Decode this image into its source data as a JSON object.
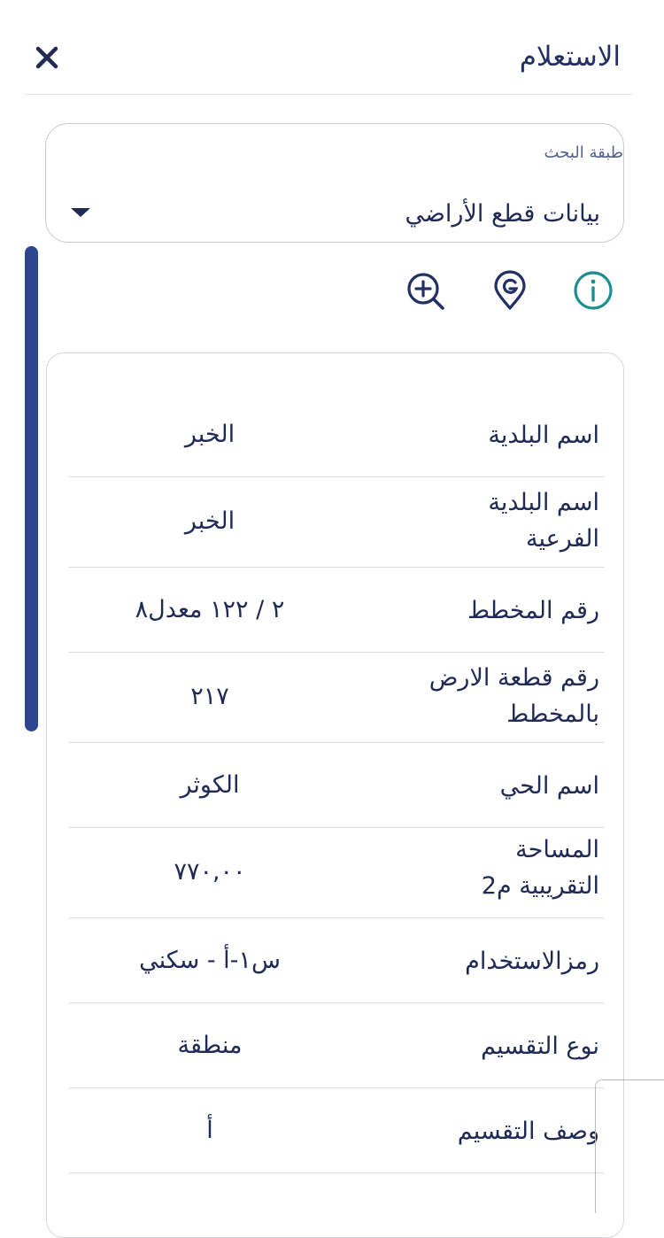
{
  "header": {
    "title": "الاستعلام"
  },
  "search_layer": {
    "label": "طبقة البحث",
    "value": "بيانات قطع الأراضي"
  },
  "toolbar": {
    "accent_color": "#1e8f8f",
    "icon_color": "#233063"
  },
  "details": [
    {
      "label": "اسم البلدية",
      "value": "الخبر"
    },
    {
      "label": "اسم البلدية الفرعية",
      "value": "الخبر"
    },
    {
      "label": "رقم المخطط",
      "value": "٢ / ١٢٢ معدل٨"
    },
    {
      "label": "رقم قطعة الارض بالمخطط",
      "value": "٢١٧"
    },
    {
      "label": "اسم الحي",
      "value": "الكوثر"
    },
    {
      "label": "المساحة التقريبية م2",
      "value": "٧٧٠,٠٠"
    },
    {
      "label": "رمزالاستخدام",
      "value": "س١-أ - سكني"
    },
    {
      "label": "نوع التقسيم",
      "value": "منطقة"
    },
    {
      "label": "وصف التقسيم",
      "value": "أ"
    }
  ]
}
